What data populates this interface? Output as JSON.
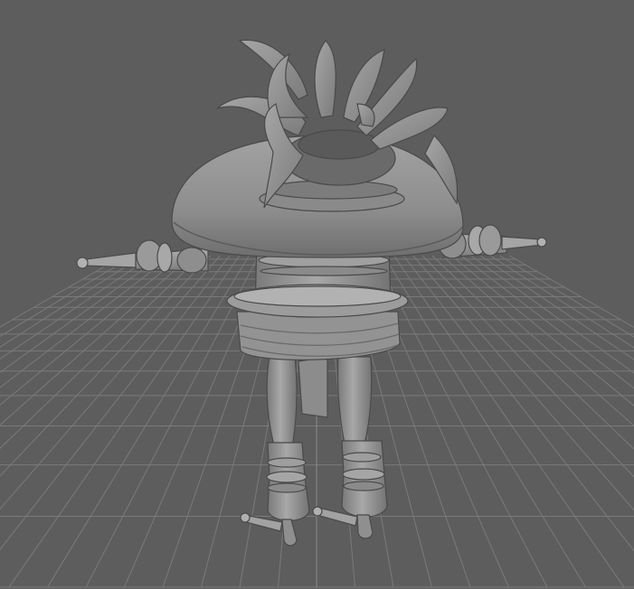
{
  "viewport": {
    "background": "#5d5d5d",
    "grid_color": "#7a7a7a",
    "grid_major_color": "#8c8c8c",
    "model_color": "#9a9a9a",
    "model_shadow": "#3f3f3f",
    "model_highlight": "#b4b4b4",
    "show_grid": true
  },
  "model": {
    "name": "character-model",
    "parts": [
      "leaf-crown",
      "mushroom-cap",
      "left-arm",
      "right-arm",
      "torso",
      "belt-ring",
      "skirt",
      "left-leg",
      "right-leg",
      "left-boot",
      "right-boot"
    ]
  }
}
